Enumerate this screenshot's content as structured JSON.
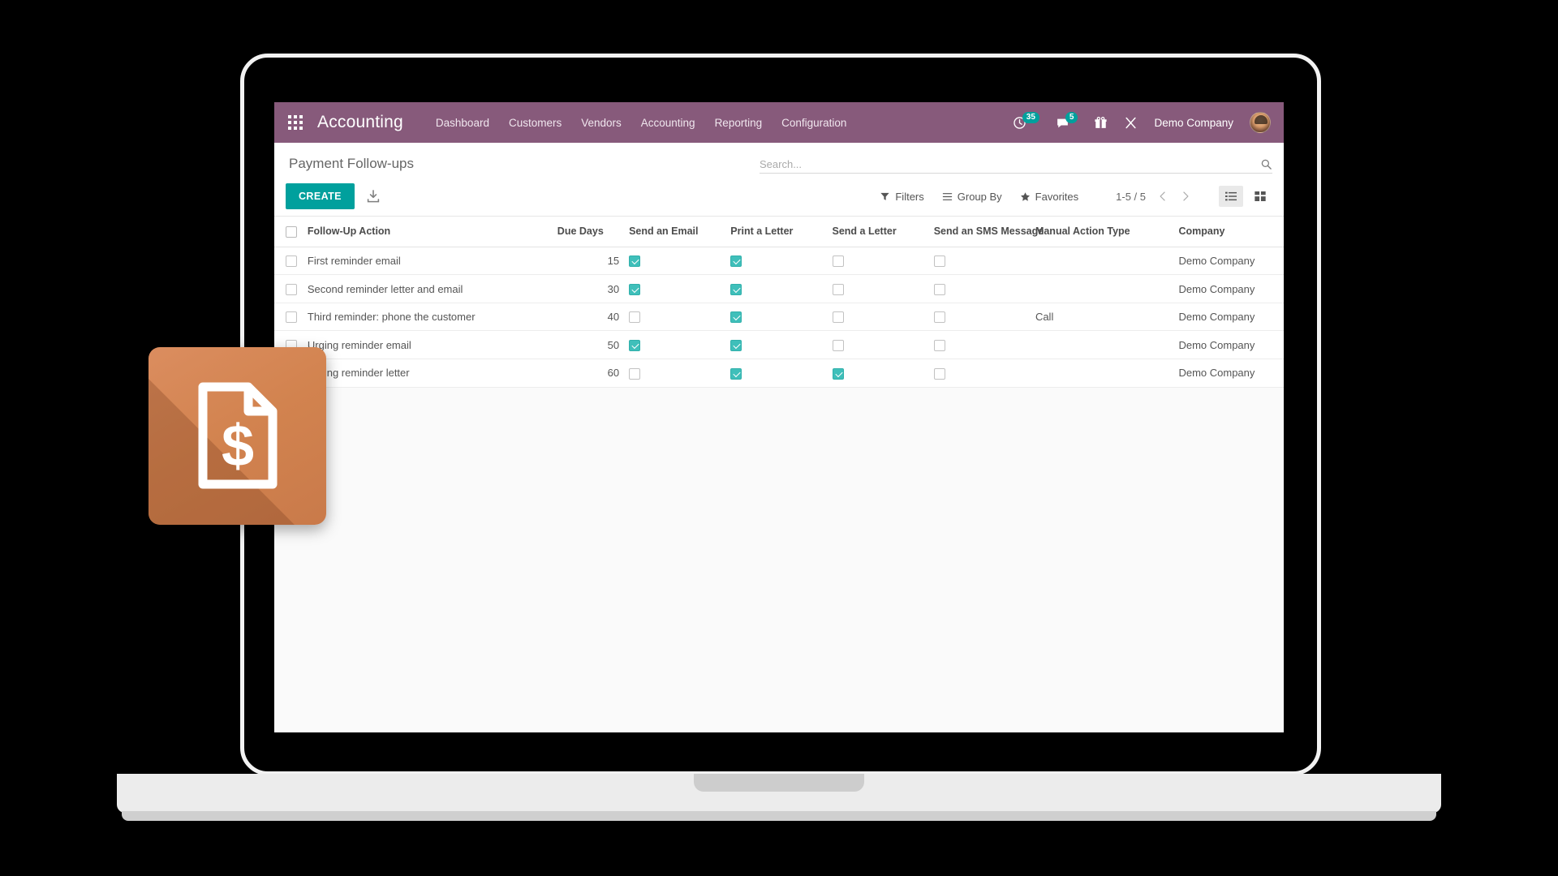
{
  "app": {
    "brand": "Accounting",
    "apps_menu_icon": "apps-grid-icon",
    "navbar_color": "#875a7b",
    "accent_color": "#00a09d"
  },
  "navbar": {
    "menu_items": [
      {
        "label": "Dashboard"
      },
      {
        "label": "Customers"
      },
      {
        "label": "Vendors"
      },
      {
        "label": "Accounting"
      },
      {
        "label": "Reporting"
      },
      {
        "label": "Configuration"
      }
    ],
    "systray": {
      "activities": {
        "icon": "clock-activity-icon",
        "badge": "35"
      },
      "messages": {
        "icon": "chat-bubble-icon",
        "badge": "5"
      },
      "gift": {
        "icon": "gift-icon"
      },
      "shortcut": {
        "icon": "close-x-icon"
      },
      "company": "Demo Company",
      "avatar": "user-avatar"
    }
  },
  "control_panel": {
    "title": "Payment Follow-ups",
    "create_label": "CREATE",
    "import_icon": "import-download-icon",
    "search": {
      "placeholder": "Search...",
      "value": "",
      "icon": "search-icon"
    },
    "filters": [
      {
        "label": "Filters",
        "icon": "filter-funnel-icon"
      },
      {
        "label": "Group By",
        "icon": "group-by-lines-icon"
      },
      {
        "label": "Favorites",
        "icon": "star-icon"
      }
    ],
    "pager": {
      "range": "1-5 / 5",
      "prev_icon": "chevron-left-icon",
      "next_icon": "chevron-right-icon"
    },
    "views": [
      {
        "name": "list",
        "icon": "list-view-icon",
        "active": true
      },
      {
        "name": "kanban",
        "icon": "kanban-view-icon",
        "active": false
      }
    ]
  },
  "list": {
    "columns": [
      {
        "key": "select",
        "label": ""
      },
      {
        "key": "name",
        "label": "Follow-Up Action"
      },
      {
        "key": "due_days",
        "label": "Due Days"
      },
      {
        "key": "send_email",
        "label": "Send an Email"
      },
      {
        "key": "print_letter",
        "label": "Print a Letter"
      },
      {
        "key": "send_letter",
        "label": "Send a Letter"
      },
      {
        "key": "send_sms",
        "label": "Send an SMS Message"
      },
      {
        "key": "manual_action",
        "label": "Manual Action Type"
      },
      {
        "key": "company",
        "label": "Company"
      }
    ],
    "rows": [
      {
        "name": "First reminder email",
        "due_days": "15",
        "send_email": true,
        "print_letter": true,
        "send_letter": false,
        "send_sms": false,
        "manual_action": "",
        "company": "Demo Company"
      },
      {
        "name": "Second reminder letter and email",
        "due_days": "30",
        "send_email": true,
        "print_letter": true,
        "send_letter": false,
        "send_sms": false,
        "manual_action": "",
        "company": "Demo Company"
      },
      {
        "name": "Third reminder: phone the customer",
        "due_days": "40",
        "send_email": false,
        "print_letter": true,
        "send_letter": false,
        "send_sms": false,
        "manual_action": "Call",
        "company": "Demo Company"
      },
      {
        "name": "Urging reminder email",
        "due_days": "50",
        "send_email": true,
        "print_letter": true,
        "send_letter": false,
        "send_sms": false,
        "manual_action": "",
        "company": "Demo Company"
      },
      {
        "name": "Urging reminder letter",
        "due_days": "60",
        "send_email": false,
        "print_letter": true,
        "send_letter": true,
        "send_sms": false,
        "manual_action": "",
        "company": "Demo Company"
      }
    ]
  },
  "decoration": {
    "app_icon": {
      "name": "accounting-invoice-app-icon",
      "glyph": "document-with-dollar-sign",
      "color": "#d2834f"
    },
    "device": "laptop-mockup"
  }
}
